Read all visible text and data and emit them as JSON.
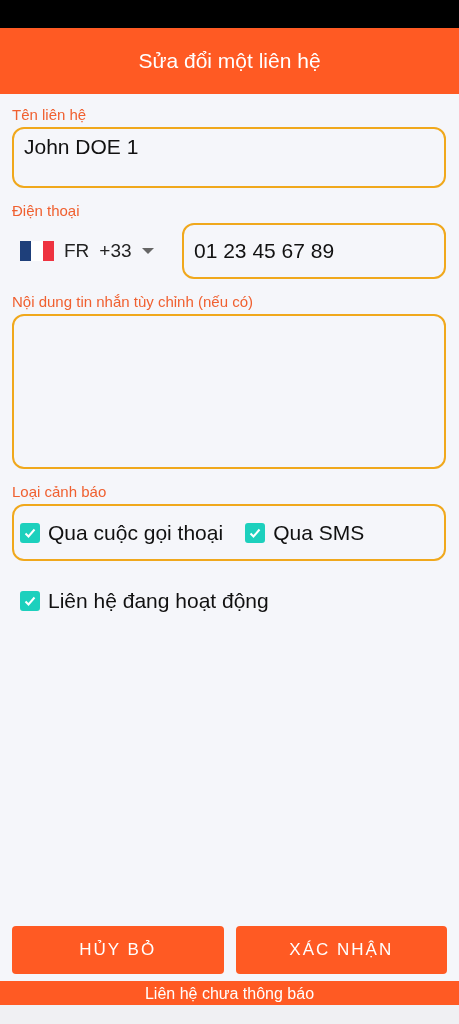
{
  "header": {
    "title": "Sửa đổi một liên hệ"
  },
  "name_field": {
    "label": "Tên liên hệ",
    "value": "John DOE 1"
  },
  "phone": {
    "label": "Điện thoại",
    "country_code": "FR",
    "dial_code": "+33",
    "value": "01 23 45 67 89"
  },
  "message_field": {
    "label": "Nội dung tin nhắn tùy chỉnh (nếu có)"
  },
  "alert_type": {
    "label": "Loại cảnh báo",
    "options": [
      {
        "label": "Qua cuộc gọi thoại",
        "checked": true
      },
      {
        "label": "Qua SMS",
        "checked": true
      }
    ]
  },
  "active": {
    "label": "Liên hệ đang hoạt động",
    "checked": true
  },
  "buttons": [
    "HỦY BỎ",
    "XÁC NHẬN"
  ],
  "status": "Liên hệ chưa thông báo"
}
